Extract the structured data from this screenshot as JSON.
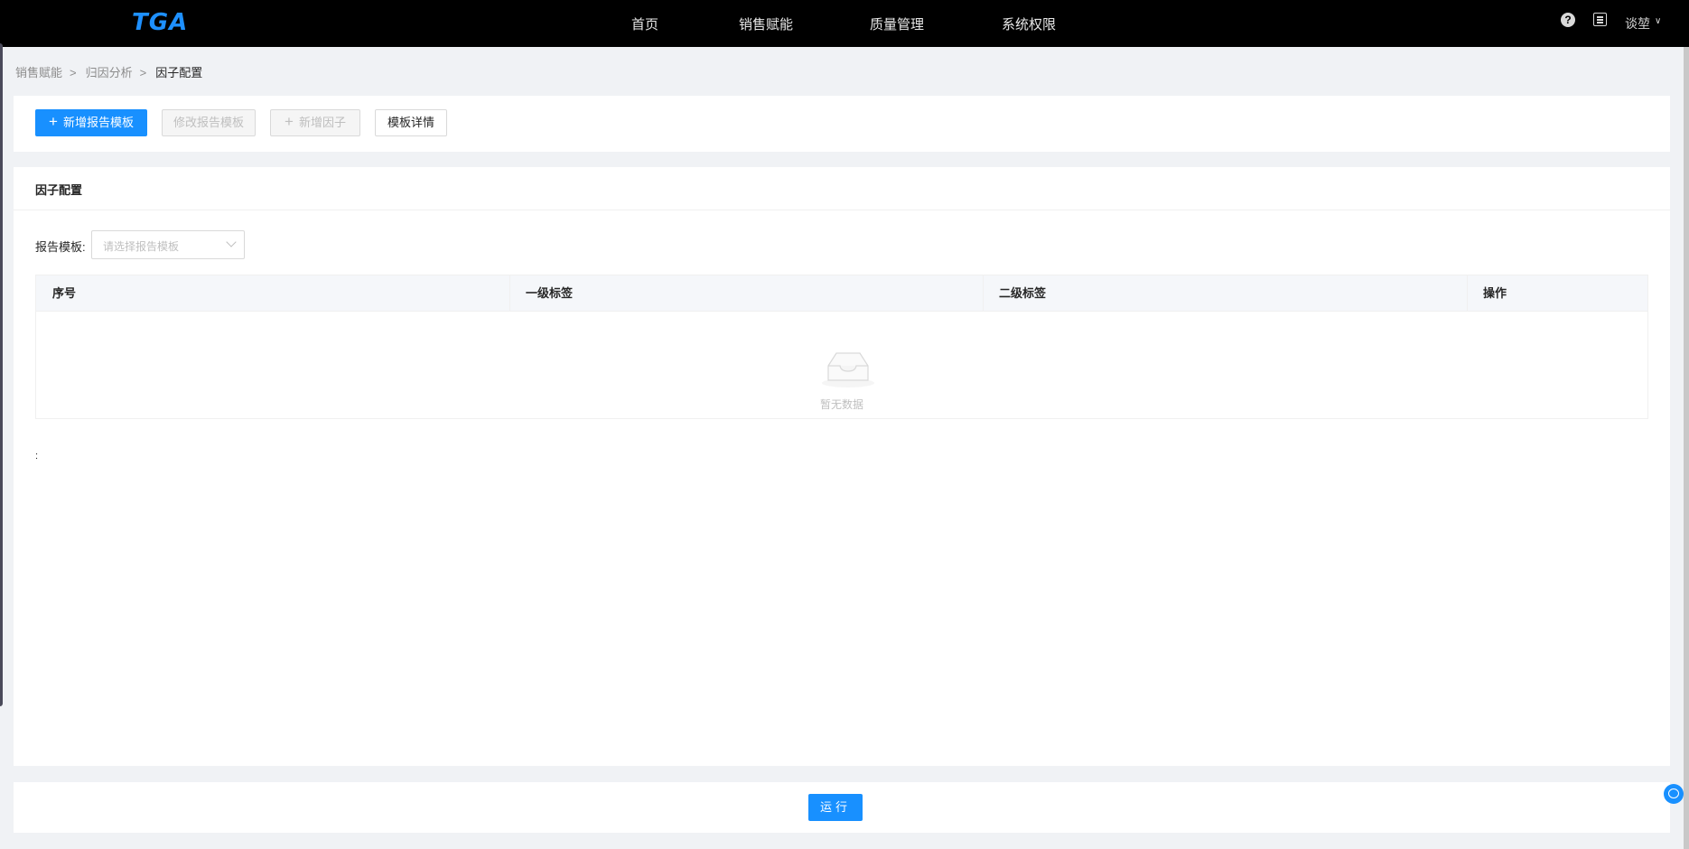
{
  "header": {
    "logo": "TGA",
    "nav": [
      "首页",
      "销售赋能",
      "质量管理",
      "系统权限"
    ],
    "help_icon": "?",
    "user_name": "谈堃",
    "user_chevron": "∨"
  },
  "breadcrumb": {
    "items": [
      "销售赋能",
      "归因分析",
      "因子配置"
    ],
    "separator": ">"
  },
  "toolbar": {
    "add_template": "新增报告模板",
    "edit_template": "修改报告模板",
    "add_factor": "新增因子",
    "template_detail": "模板详情",
    "plus": "+"
  },
  "main": {
    "title": "因子配置",
    "filter_label": "报告模板:",
    "select_placeholder": "请选择报告模板",
    "columns": [
      "序号",
      "一级标签",
      "二级标签",
      "操作"
    ],
    "empty_text": "暂无数据",
    "stray_mark": ":"
  },
  "footer": {
    "run_label": "运行"
  }
}
